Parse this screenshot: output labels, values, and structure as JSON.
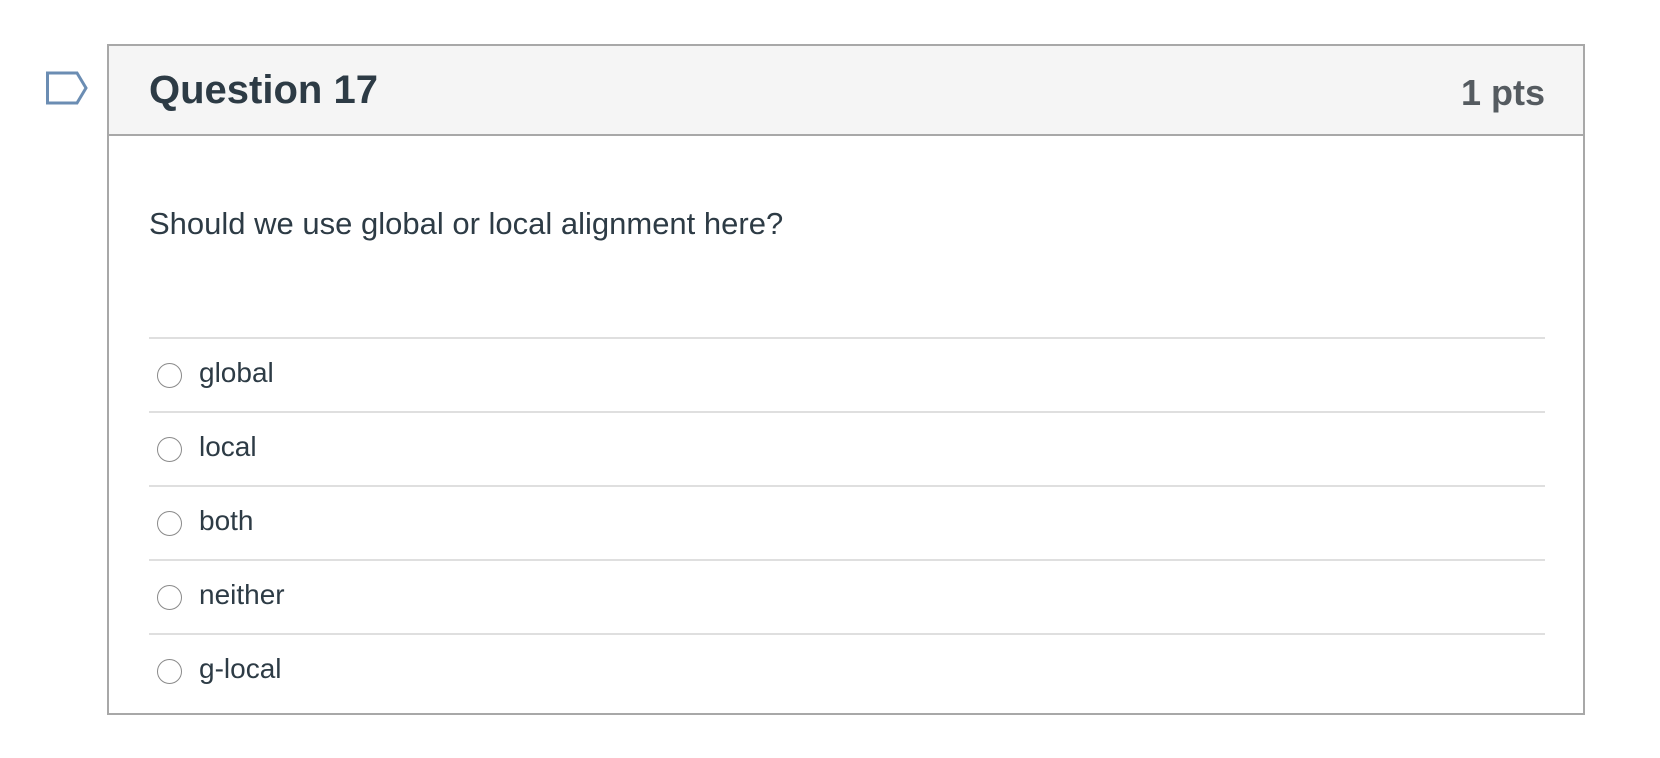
{
  "question": {
    "title": "Question 17",
    "points": "1 pts",
    "text": "Should we use global or local alignment here?",
    "flag_icon": "flag-outline-icon",
    "options": [
      {
        "label": "global",
        "selected": false
      },
      {
        "label": "local",
        "selected": false
      },
      {
        "label": "both",
        "selected": false
      },
      {
        "label": "neither",
        "selected": false
      },
      {
        "label": "g-local",
        "selected": false
      }
    ]
  },
  "colors": {
    "text": "#2d3b45",
    "header_bg": "#f5f5f5",
    "border": "#a8a8a8",
    "divider": "#dfdfdf",
    "flag": "#6b8db3",
    "points": "#555b60"
  }
}
